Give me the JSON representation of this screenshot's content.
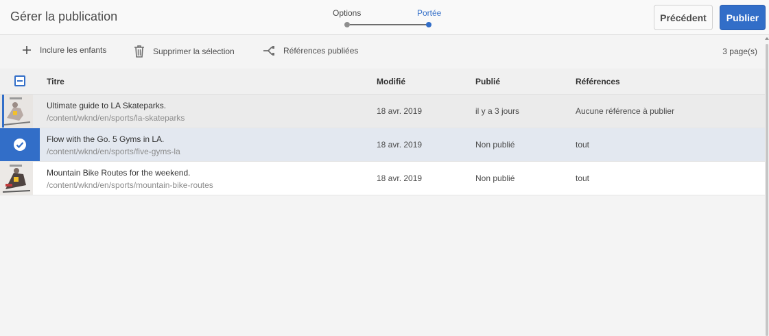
{
  "header": {
    "title": "Gérer la publication",
    "steps": [
      {
        "label": "Options",
        "state": "done"
      },
      {
        "label": "Portée",
        "state": "active"
      }
    ],
    "prev_label": "Précédent",
    "publish_label": "Publier"
  },
  "toolbar": {
    "include_children": "Inclure les enfants",
    "delete_selection": "Supprimer la sélection",
    "published_refs": "Références publiées",
    "page_count": "3 page(s)"
  },
  "table": {
    "columns": [
      "Titre",
      "Modifié",
      "Publié",
      "Références"
    ],
    "rows": [
      {
        "title": "Ultimate guide to LA Skateparks.",
        "path": "/content/wknd/en/sports/la-skateparks",
        "modified": "18 avr. 2019",
        "published": "il y a 3 jours",
        "references": "Aucune référence à publier"
      },
      {
        "title": "Flow with the Go. 5 Gyms in LA.",
        "path": "/content/wknd/en/sports/five-gyms-la",
        "modified": "18 avr. 2019",
        "published": "Non publié",
        "references": "tout"
      },
      {
        "title": "Mountain Bike Routes for the weekend.",
        "path": "/content/wknd/en/sports/mountain-bike-routes",
        "modified": "18 avr. 2019",
        "published": "Non publié",
        "references": "tout"
      }
    ]
  },
  "colors": {
    "accent": "#326ec8",
    "selected_row": "#e3e8f0"
  }
}
